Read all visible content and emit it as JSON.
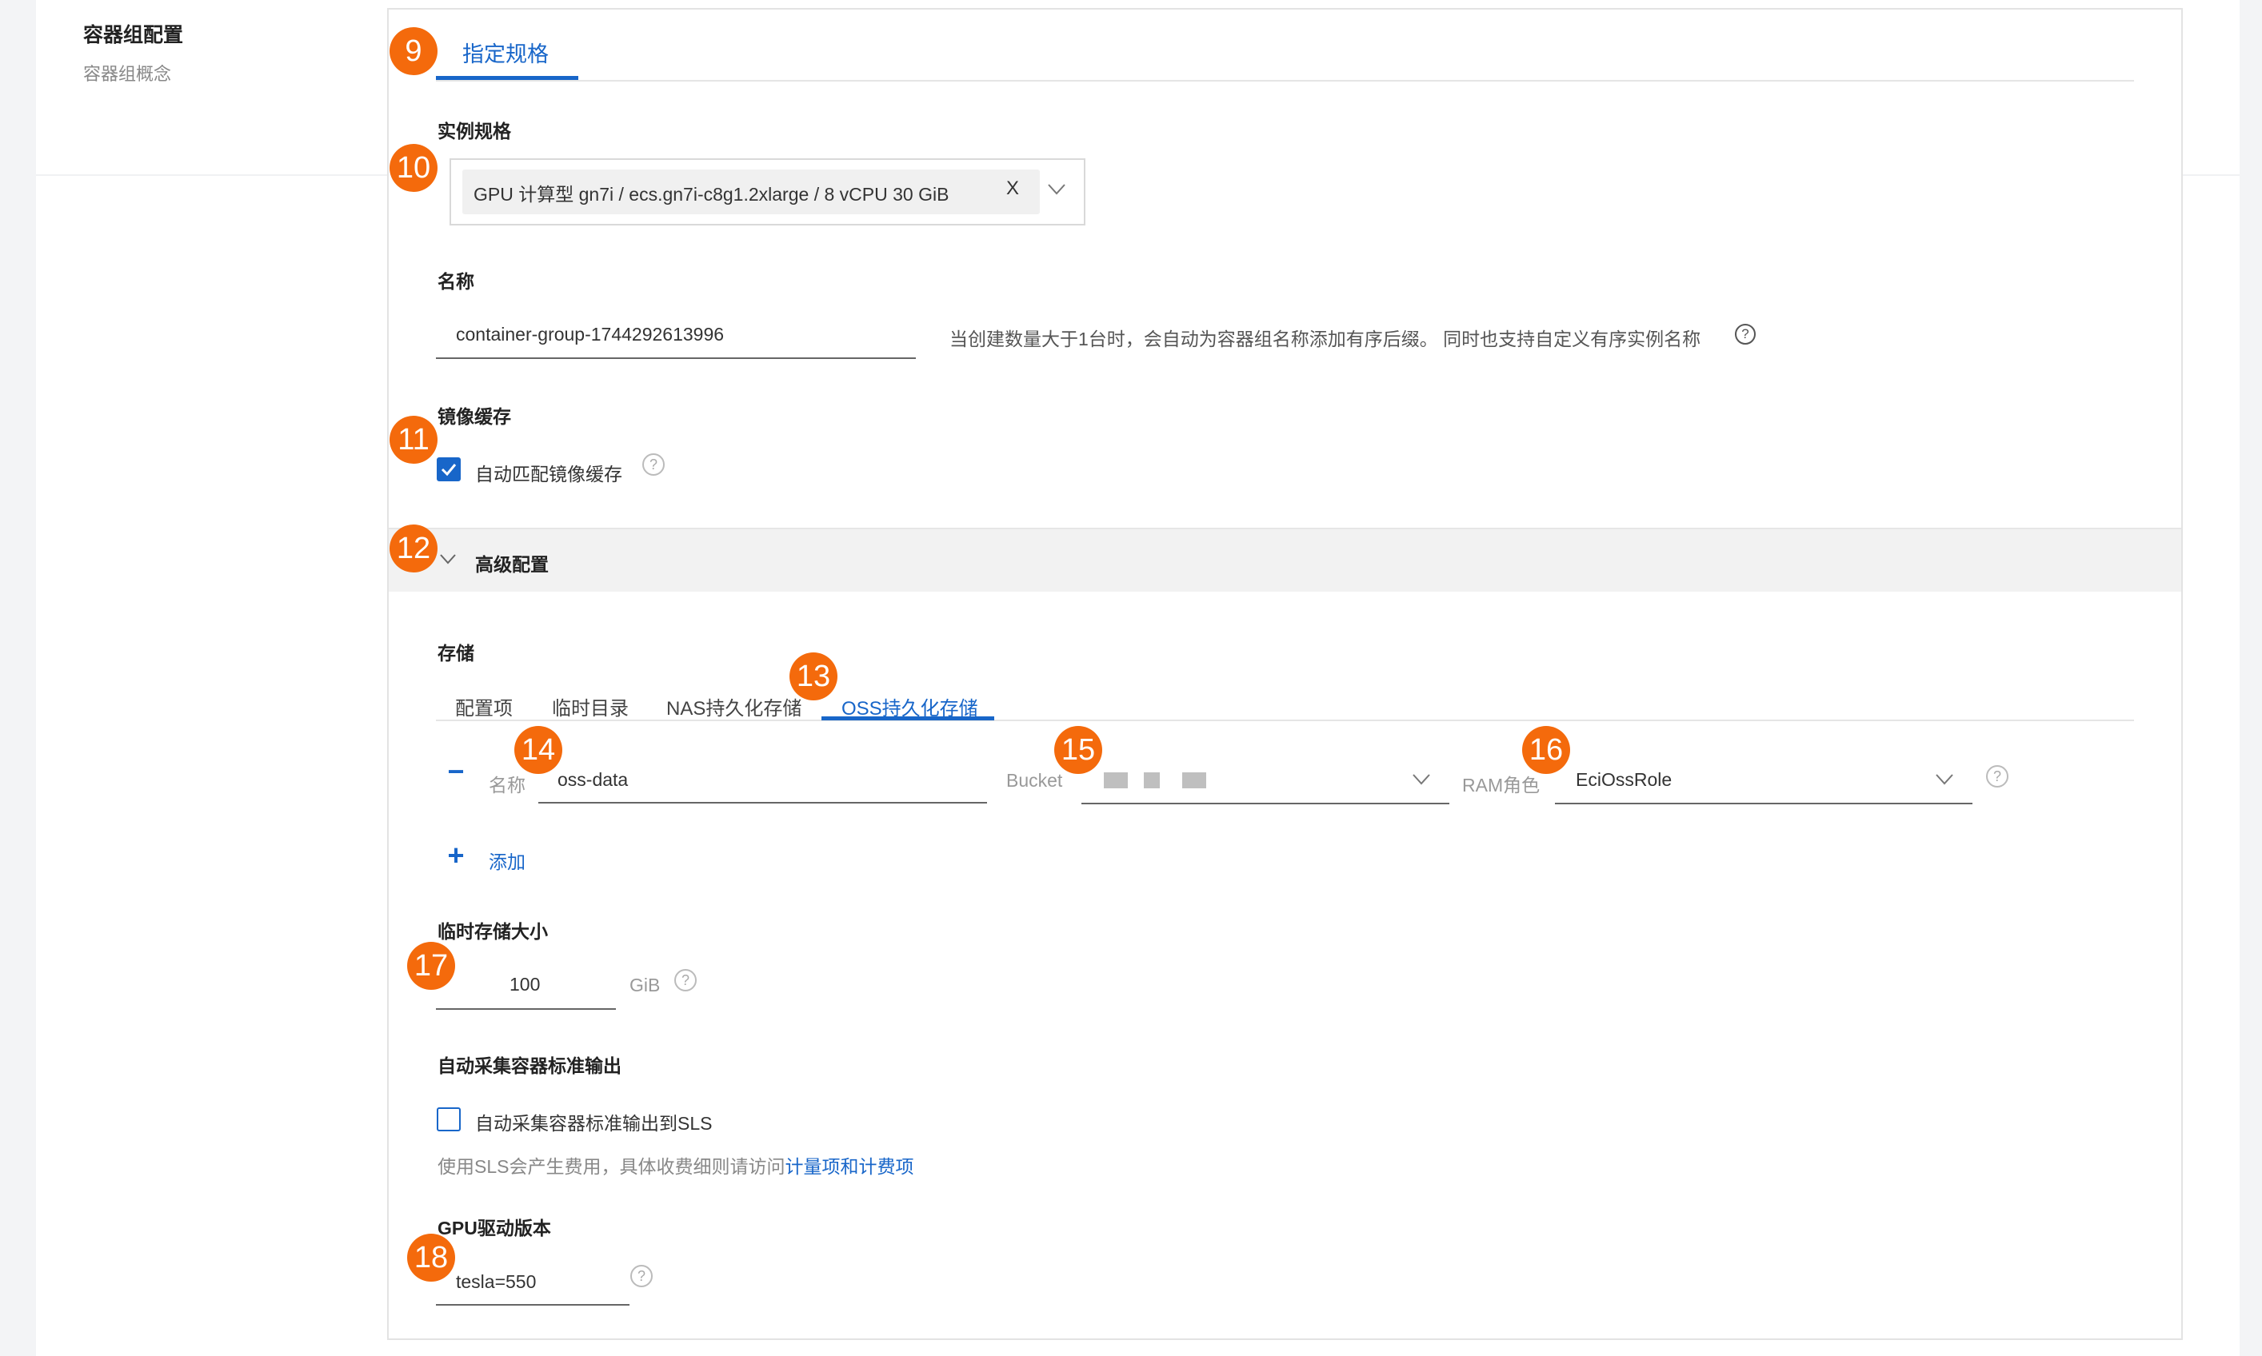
{
  "section": {
    "title": "容器组配置",
    "subtitle": "容器组概念"
  },
  "tabs": {
    "main_tab": "指定规格"
  },
  "instance_spec": {
    "label": "实例规格",
    "selected_value": "GPU 计算型 gn7i / ecs.gn7i-c8g1.2xlarge / 8 vCPU 30 GiB",
    "clear_glyph": "X"
  },
  "name": {
    "label": "名称",
    "value": "container-group-1744292613996",
    "hint": "当创建数量大于1台时，会自动为容器组名称添加有序后缀。 同时也支持自定义有序实例名称"
  },
  "image_cache": {
    "label": "镜像缓存",
    "checkbox_label": "自动匹配镜像缓存",
    "checked": true
  },
  "advanced": {
    "title": "高级配置"
  },
  "storage": {
    "label": "存储",
    "tabs": [
      "配置项",
      "临时目录",
      "NAS持久化存储",
      "OSS持久化存储"
    ],
    "active_tab": "OSS持久化存储",
    "row": {
      "name_label": "名称",
      "name_value": "oss-data",
      "bucket_label": "Bucket",
      "ram_label": "RAM角色",
      "ram_value": "EciOssRole"
    },
    "add_label": "添加"
  },
  "temp_storage": {
    "label": "临时存储大小",
    "value": "100",
    "unit": "GiB"
  },
  "stdout": {
    "label": "自动采集容器标准输出",
    "checkbox_label": "自动采集容器标准输出到SLS",
    "checked": false,
    "note_prefix": "使用SLS会产生费用，具体收费细则请访问",
    "note_link": "计量项和计费项"
  },
  "gpu_driver": {
    "label": "GPU驱动版本",
    "value": "tesla=550"
  },
  "help_glyph": "?",
  "minus_glyph": "−",
  "plus_glyph": "+",
  "annotations": [
    "9",
    "10",
    "11",
    "12",
    "13",
    "14",
    "15",
    "16",
    "17",
    "18"
  ],
  "colors": {
    "accent": "#1866c9",
    "badge": "#f46a0c",
    "adv_bar": "#f2f2f2"
  }
}
